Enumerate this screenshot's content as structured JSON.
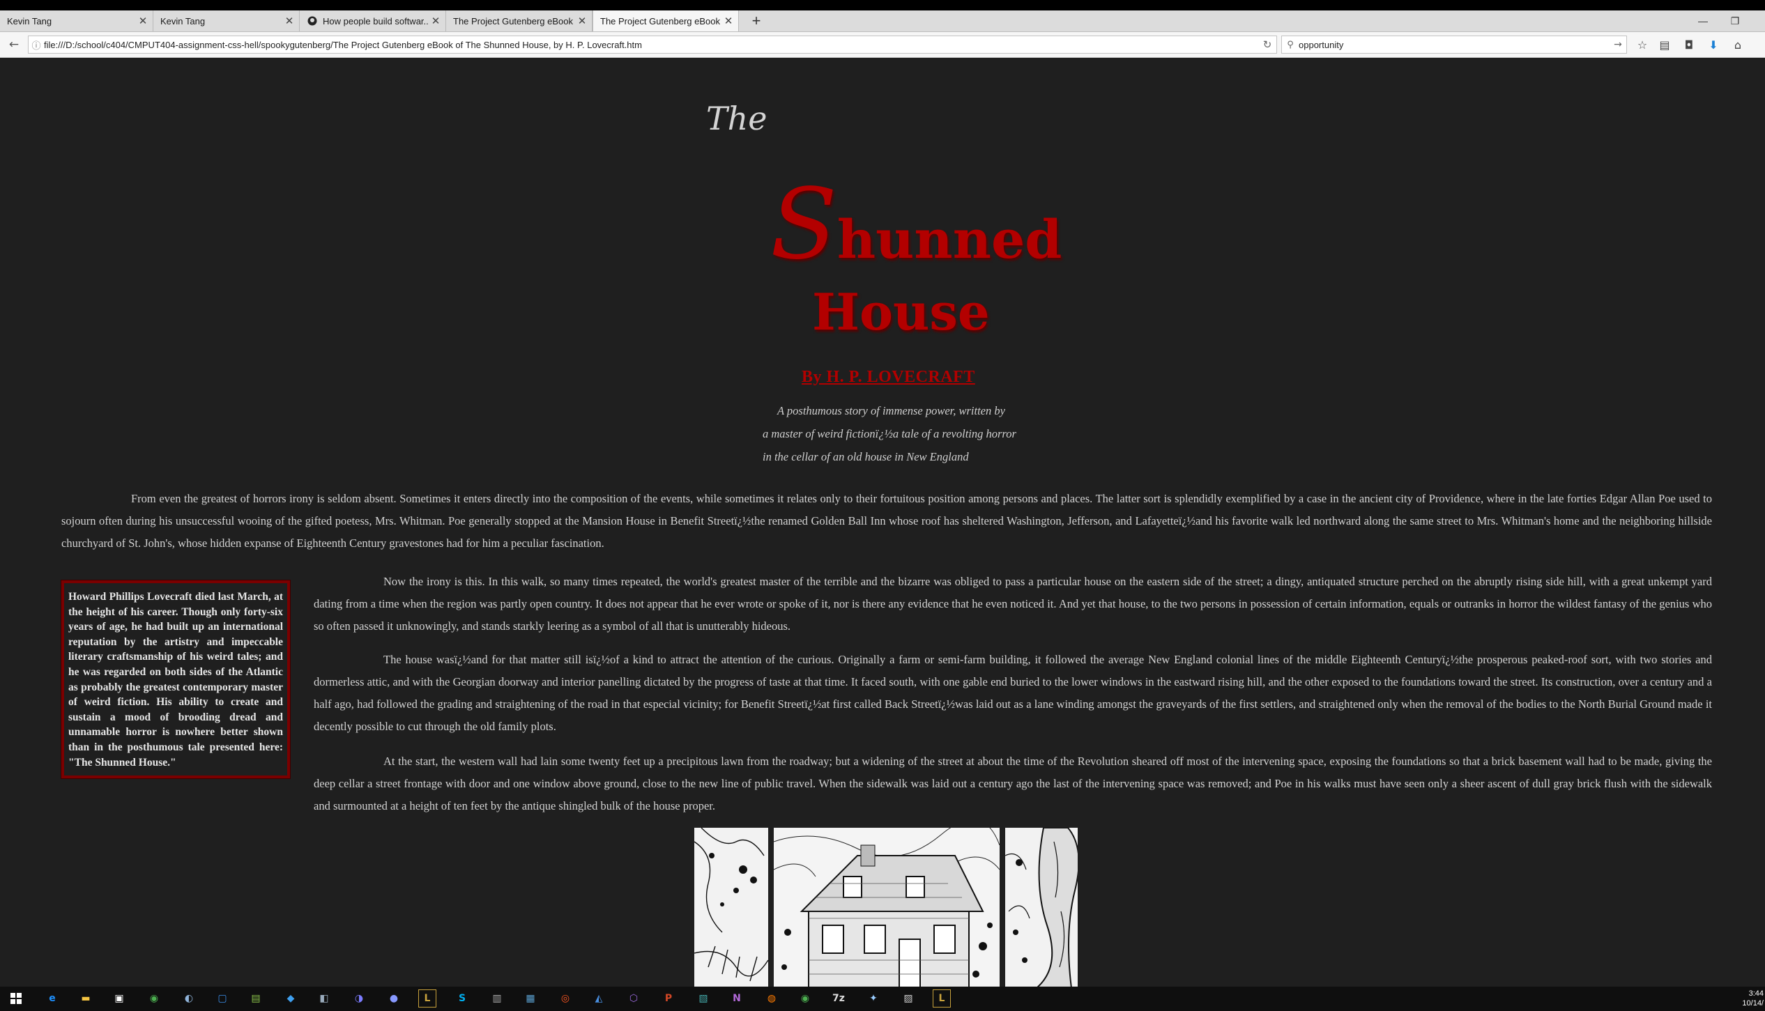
{
  "browser": {
    "tabs": [
      {
        "label": "Kevin Tang",
        "active": false
      },
      {
        "label": "Kevin Tang",
        "active": false
      },
      {
        "label": "How people build softwar...",
        "active": false
      },
      {
        "label": "The Project Gutenberg eBook ...",
        "active": false
      },
      {
        "label": "The Project Gutenberg eBook ...",
        "active": true
      }
    ],
    "new_tab": "+",
    "url": "file:///D:/school/c404/CMPUT404-assignment-css-hell/spookygutenberg/The Project Gutenberg eBook of The Shunned House, by H. P. Lovecraft.htm",
    "search_value": "opportunity"
  },
  "page": {
    "title_the": "The",
    "title_s": "S",
    "title_hunned": "hunned",
    "title_house": "House",
    "byline": "By H. P. LOVECRAFT",
    "blurb": [
      "A posthumous story of immense power, written by",
      "a master of weird fictionï¿½a tale of a revolting horror",
      "in the cellar of an old house in New England"
    ],
    "paragraphs": [
      "From even the greatest of horrors irony is seldom absent. Sometimes it enters directly into the composition of the events, while sometimes it relates only to their fortuitous position among persons and places. The latter sort is splendidly exemplified by a case in the ancient city of Providence, where in the late forties Edgar Allan Poe used to sojourn often during his unsuccessful wooing of the gifted poetess, Mrs. Whitman. Poe generally stopped at the Mansion House in Benefit Streetï¿½the renamed Golden Ball Inn whose roof has sheltered Washington, Jefferson, and Lafayetteï¿½and his favorite walk led northward along the same street to Mrs. Whitman's home and the neighboring hillside churchyard of St. John's, whose hidden expanse of Eighteenth Century gravestones had for him a peculiar fascination.",
      "Now the irony is this. In this walk, so many times repeated, the world's greatest master of the terrible and the bizarre was obliged to pass a particular house on the eastern side of the street; a dingy, antiquated structure perched on the abruptly rising side hill, with a great unkempt yard dating from a time when the region was partly open country. It does not appear that he ever wrote or spoke of it, nor is there any evidence that he even noticed it. And yet that house, to the two persons in possession of certain information, equals or outranks in horror the wildest fantasy of the genius who so often passed it unknowingly, and stands starkly leering as a symbol of all that is unutterably hideous.",
      "The house wasï¿½and for that matter still isï¿½of a kind to attract the attention of the curious. Originally a farm or semi-farm building, it followed the average New England colonial lines of the middle Eighteenth Centuryï¿½the prosperous peaked-roof sort, with two stories and dormerless attic, and with the Georgian doorway and interior panelling dictated by the progress of taste at that time. It faced south, with one gable end buried to the lower windows in the eastward rising hill, and the other exposed to the foundations toward the street. Its construction, over a century and a half ago, had followed the grading and straightening of the road in that especial vicinity; for Benefit Streetï¿½at first called Back Streetï¿½was laid out as a lane winding amongst the graveyards of the first settlers, and straightened only when the removal of the bodies to the North Burial Ground made it decently possible to cut through the old family plots.",
      "At the start, the western wall had lain some twenty feet up a precipitous lawn from the roadway; but a widening of the street at about the time of the Revolution sheared off most of the intervening space, exposing the foundations so that a brick basement wall had to be made, giving the deep cellar a street frontage with door and one window above ground, close to the new line of public travel. When the sidewalk was laid out a century ago the last of the intervening space was removed; and Poe in his walks must have seen only a sheer ascent of dull gray brick flush with the sidewalk and surmounted at a height of ten feet by the antique shingled bulk of the house proper."
    ],
    "sidebox": "Howard Phillips Lovecraft died last March, at the height of his career. Though only forty-six years of age, he had built up an international reputation by the artistry and impeccable literary craftsmanship of his weird tales; and he was regarded on both sides of the Atlantic as probably the greatest contemporary master of weird fiction. His ability to create and sustain a mood of brooding dread and unnamable horror is nowhere better shown than in the posthumous tale presented here: \"The Shunned House.\""
  },
  "taskbar": {
    "clock_time": "3:44",
    "clock_date": "10/14/"
  },
  "colors": {
    "page_bg": "#1f1f1f",
    "title_red": "#b30000",
    "text": "#d2d2d2",
    "box_border": "#7a0000"
  }
}
